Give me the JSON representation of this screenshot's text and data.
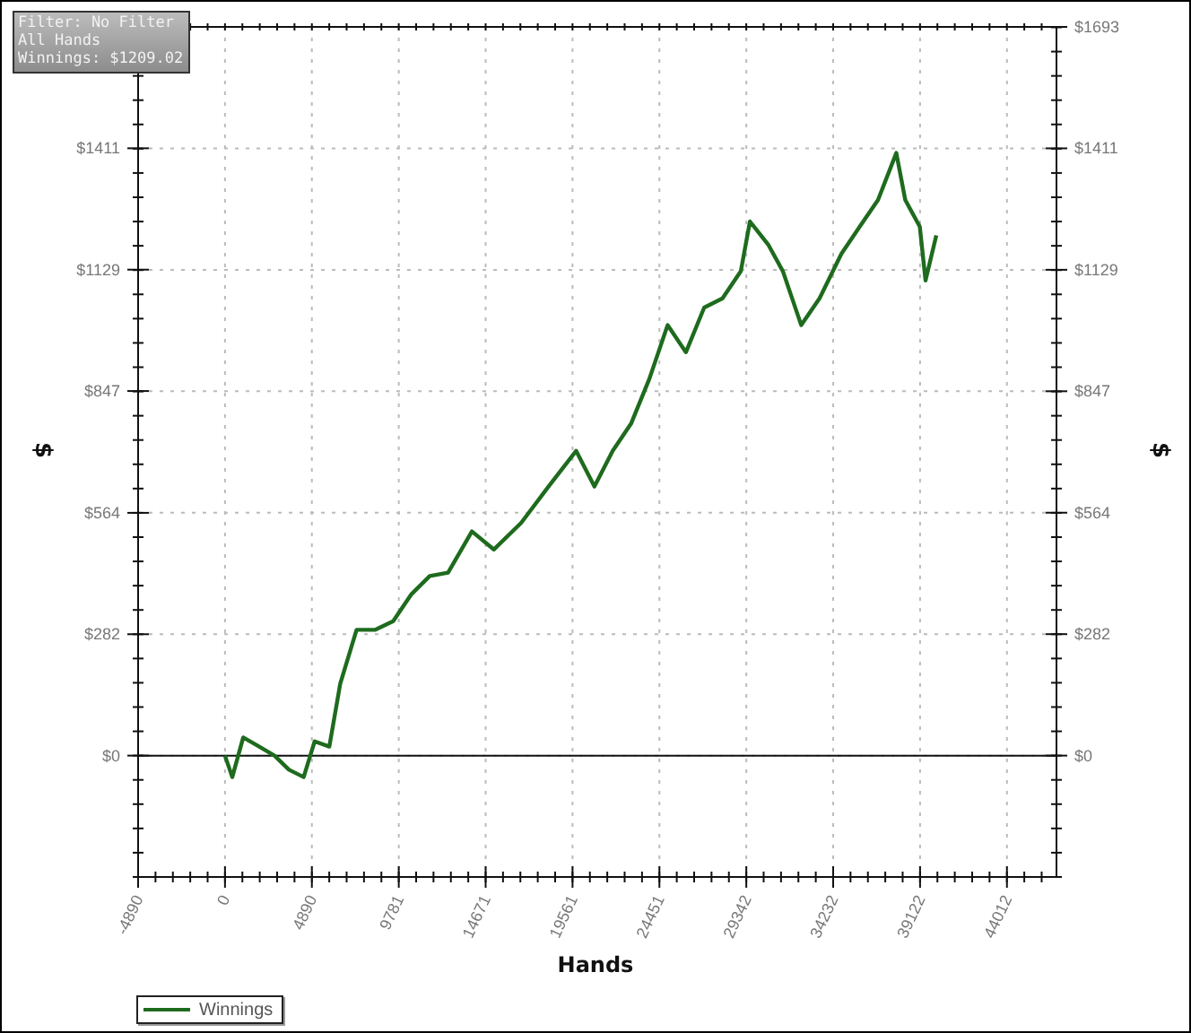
{
  "info_box": {
    "lines": [
      "Filter: No Filter",
      "All Hands",
      "Winnings: $1209.02"
    ]
  },
  "chart": {
    "chart_data": {
      "type": "line",
      "grid": true,
      "xlabel": "Hands",
      "ylabel": "$",
      "xlim": [
        -4890,
        46800
      ],
      "ylim": [
        -282,
        1693
      ],
      "xticks": [
        {
          "value": -4890,
          "label": "-4890"
        },
        {
          "value": 0,
          "label": "0"
        },
        {
          "value": 4890,
          "label": "4890"
        },
        {
          "value": 9781,
          "label": "9781"
        },
        {
          "value": 14671,
          "label": "14671"
        },
        {
          "value": 19561,
          "label": "19561"
        },
        {
          "value": 24451,
          "label": "24451"
        },
        {
          "value": 29342,
          "label": "29342"
        },
        {
          "value": 34232,
          "label": "34232"
        },
        {
          "value": 39122,
          "label": "39122"
        },
        {
          "value": 44012,
          "label": "44012"
        }
      ],
      "yticks": [
        {
          "value": 0,
          "label": "$0"
        },
        {
          "value": 282,
          "label": "$282"
        },
        {
          "value": 564,
          "label": "$564"
        },
        {
          "value": 847,
          "label": "$847"
        },
        {
          "value": 1129,
          "label": "$1129"
        },
        {
          "value": 1411,
          "label": "$1411"
        }
      ],
      "x": [
        0,
        412,
        1030,
        1750,
        2780,
        3600,
        4430,
        5040,
        5870,
        6490,
        7410,
        8440,
        9470,
        10500,
        11530,
        12560,
        13900,
        15130,
        16670,
        18210,
        19760,
        20790,
        21820,
        22850,
        23880,
        24910,
        25940,
        26970,
        28000,
        29030,
        29550,
        30580,
        31400,
        32430,
        33460,
        34700,
        35720,
        36750,
        37780,
        38290,
        39110,
        39430,
        40040
      ],
      "series": [
        {
          "name": "Winnings",
          "color": "#1e6b1e",
          "values": [
            0,
            -50,
            42,
            25,
            0,
            -33,
            -50,
            33,
            21,
            167,
            292,
            292,
            312,
            375,
            417,
            425,
            521,
            479,
            541,
            625,
            708,
            625,
            708,
            771,
            875,
            1000,
            937,
            1041,
            1062,
            1125,
            1241,
            1187,
            1125,
            1000,
            1062,
            1166,
            1229,
            1291,
            1400,
            1291,
            1229,
            1104,
            1209
          ]
        }
      ]
    },
    "right_axis": {
      "title": "$",
      "labels": [
        "$1693",
        "$1411",
        "$1129",
        "$847",
        "$564",
        "$282",
        "$0"
      ]
    }
  }
}
